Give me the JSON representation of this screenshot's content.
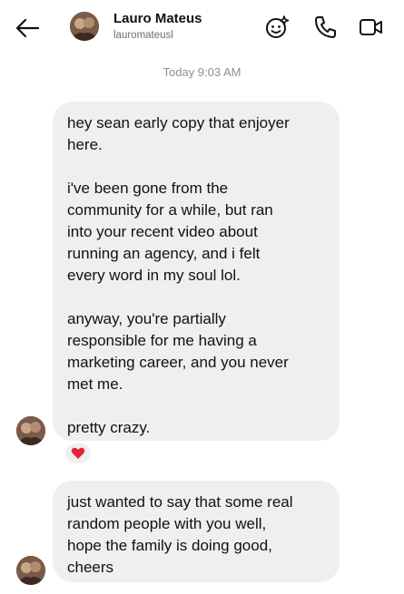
{
  "header": {
    "name": "Lauro Mateus",
    "handle": "lauromateusl",
    "icons": [
      "back-arrow-icon",
      "avatar",
      "sparkle-emoji-icon",
      "phone-icon",
      "video-camera-icon"
    ]
  },
  "timestamp": "Today 9:03 AM",
  "messages": [
    {
      "paragraphs": [
        "hey sean early copy that enjoyer\nhere.",
        "i've been gone from the\ncommunity for a while, but ran\ninto your recent video about\nrunning an agency, and i felt\nevery word in my soul lol.",
        "anyway, you're partially\nresponsible for me having a\nmarketing career, and you never\nmet me.",
        "pretty crazy."
      ],
      "reaction": "heart"
    },
    {
      "paragraphs": [
        "just wanted to say that some real\nrandom people with you well,\nhope the family is doing good,\ncheers"
      ]
    }
  ],
  "colors": {
    "bubble": "#efefef",
    "timestamp": "#8e8e8e",
    "reaction": "#e0243a"
  }
}
